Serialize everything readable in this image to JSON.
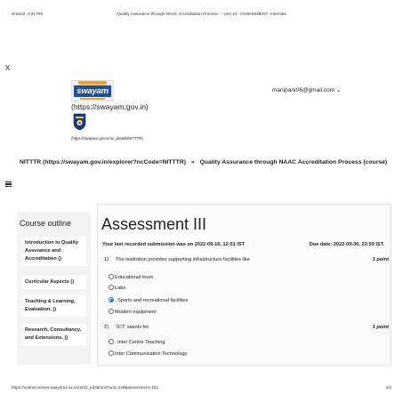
{
  "print_header": {
    "datetime": "9/16/22, 3:01 PM",
    "title": "Quality Assurance through NAAC Accreditation Process - - Unit 10 - ASSESSMENT -Internals"
  },
  "close_label": "X",
  "header": {
    "logo_text": "swayam",
    "swayam_link": "(https://swayam.gov.in)",
    "nitttr_link": "(https://swayam.gov.in/nc_details/NITTTR)",
    "user_email": "manipark06@gmail.com",
    "user_menu_caret": "⌄"
  },
  "breadcrumb": {
    "provider": "NITTTR (https://swayam.gov.in/explorer?ncCode=NITTTR)",
    "separator": "»",
    "course": "Quality Assurance through NAAC Accreditation Process (course)"
  },
  "sidebar": {
    "title": "Course outline",
    "items": [
      {
        "label": "Introduction to Quality Assurance and Accreditation ()"
      },
      {
        "label": "Curricular Aspects ()"
      },
      {
        "label": "Teaching & Learning, Evaluation. ()"
      },
      {
        "label": "Research, Consultancy, and Extensions. ()"
      }
    ]
  },
  "assessment": {
    "title": "Assessment III",
    "last_submission": "Your last recorded submission was on 2022-09-16, 12:51 IST",
    "due_date": "Due date: 2022-09-30, 23:59 IST.",
    "questions": [
      {
        "number": "1)",
        "text": "The institution provides supporting infrastructure facilities like",
        "points": "1 point",
        "options": [
          {
            "label": "Educational tours",
            "selected": false
          },
          {
            "label": "Labs",
            "selected": false
          },
          {
            "label": ". Sports and recreational facilities",
            "selected": true
          },
          {
            "label": "Modern equipment",
            "selected": false
          }
        ]
      },
      {
        "number": "2)",
        "text": "'ICT' stands for",
        "points": "1 point",
        "options": [
          {
            "label": ". Inter Centre Teaching",
            "selected": false
          },
          {
            "label": "Inter Communication Technology",
            "selected": false
          }
        ]
      }
    ]
  },
  "print_footer": {
    "url": "https://onlinecourses.swayam2.ac.in/ntr22_ed48/unit?unit=148&assessment=151",
    "page": "1/6"
  }
}
